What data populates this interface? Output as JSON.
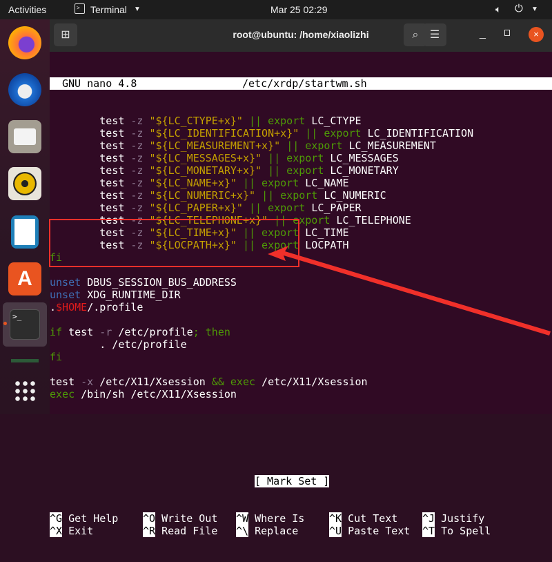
{
  "topbar": {
    "activities": "Activities",
    "app": "Terminal",
    "datetime": "Mar 25  02:29"
  },
  "dock": [
    "firefox",
    "thunderbird",
    "files",
    "rhythmbox",
    "libreoffice-writer",
    "software-center",
    "terminal",
    "show-apps"
  ],
  "window": {
    "title": "root@ubuntu: /home/xiaolizhi"
  },
  "nano": {
    "version": "GNU nano 4.8",
    "file": "/etc/xrdp/startwm.sh",
    "status": "[ Mark Set ]"
  },
  "lines": [
    [
      [
        "        test ",
        ""
      ],
      [
        "-z ",
        "op"
      ],
      [
        "\"${LC_CTYPE+x}\" ",
        "str"
      ],
      [
        "|| export ",
        "kw"
      ],
      [
        "LC_CTYPE",
        ""
      ]
    ],
    [
      [
        "        test ",
        ""
      ],
      [
        "-z ",
        "op"
      ],
      [
        "\"${LC_IDENTIFICATION+x}\" ",
        "str"
      ],
      [
        "|| export ",
        "kw"
      ],
      [
        "LC_IDENTIFICATION",
        ""
      ]
    ],
    [
      [
        "        test ",
        ""
      ],
      [
        "-z ",
        "op"
      ],
      [
        "\"${LC_MEASUREMENT+x}\" ",
        "str"
      ],
      [
        "|| export ",
        "kw"
      ],
      [
        "LC_MEASUREMENT",
        ""
      ]
    ],
    [
      [
        "        test ",
        ""
      ],
      [
        "-z ",
        "op"
      ],
      [
        "\"${LC_MESSAGES+x}\" ",
        "str"
      ],
      [
        "|| export ",
        "kw"
      ],
      [
        "LC_MESSAGES",
        ""
      ]
    ],
    [
      [
        "        test ",
        ""
      ],
      [
        "-z ",
        "op"
      ],
      [
        "\"${LC_MONETARY+x}\" ",
        "str"
      ],
      [
        "|| export ",
        "kw"
      ],
      [
        "LC_MONETARY",
        ""
      ]
    ],
    [
      [
        "        test ",
        ""
      ],
      [
        "-z ",
        "op"
      ],
      [
        "\"${LC_NAME+x}\" ",
        "str"
      ],
      [
        "|| export ",
        "kw"
      ],
      [
        "LC_NAME",
        ""
      ]
    ],
    [
      [
        "        test ",
        ""
      ],
      [
        "-z ",
        "op"
      ],
      [
        "\"${LC_NUMERIC+x}\" ",
        "str"
      ],
      [
        "|| export ",
        "kw"
      ],
      [
        "LC_NUMERIC",
        ""
      ]
    ],
    [
      [
        "        test ",
        ""
      ],
      [
        "-z ",
        "op"
      ],
      [
        "\"${LC_PAPER+x}\" ",
        "str"
      ],
      [
        "|| export ",
        "kw"
      ],
      [
        "LC_PAPER",
        ""
      ]
    ],
    [
      [
        "        test ",
        ""
      ],
      [
        "-z ",
        "op"
      ],
      [
        "\"${LC_TELEPHONE+x}\" ",
        "str"
      ],
      [
        "|| export ",
        "kw"
      ],
      [
        "LC_TELEPHONE",
        ""
      ]
    ],
    [
      [
        "        test ",
        ""
      ],
      [
        "-z ",
        "op"
      ],
      [
        "\"${LC_TIME+x}\" ",
        "str"
      ],
      [
        "|| export ",
        "kw"
      ],
      [
        "LC_TIME",
        ""
      ]
    ],
    [
      [
        "        test ",
        ""
      ],
      [
        "-z ",
        "op"
      ],
      [
        "\"${LOCPATH+x}\" ",
        "str"
      ],
      [
        "|| export ",
        "kw"
      ],
      [
        "LOCPATH",
        ""
      ]
    ],
    [
      [
        "fi",
        "kw"
      ]
    ],
    [],
    [
      [
        "unset ",
        "bl"
      ],
      [
        "DBUS_SESSION_BUS_ADDRESS",
        ""
      ]
    ],
    [
      [
        "unset ",
        "bl"
      ],
      [
        "XDG_RUNTIME_DIR",
        ""
      ]
    ],
    [
      [
        ".",
        ""
      ],
      [
        "$HOME",
        "rd"
      ],
      [
        "/.profile",
        ""
      ]
    ],
    [],
    [
      [
        "if ",
        "kw"
      ],
      [
        "test ",
        ""
      ],
      [
        "-r ",
        "op"
      ],
      [
        "/etc/profile",
        ""
      ],
      [
        "; then",
        "kw"
      ]
    ],
    [
      [
        "        . /etc/profile",
        ""
      ]
    ],
    [
      [
        "fi",
        "kw"
      ]
    ],
    [],
    [
      [
        "test ",
        ""
      ],
      [
        "-x ",
        "op"
      ],
      [
        "/etc/X11/Xsession ",
        ""
      ],
      [
        "&& exec ",
        "kw"
      ],
      [
        "/etc/X11/Xsession",
        ""
      ]
    ],
    [
      [
        "exec ",
        "kw"
      ],
      [
        "/bin/sh /etc/X11/Xsession",
        ""
      ]
    ]
  ],
  "shortcuts": [
    [
      {
        "key": "^G",
        "label": "Get Help"
      },
      {
        "key": "^O",
        "label": "Write Out"
      },
      {
        "key": "^W",
        "label": "Where Is"
      },
      {
        "key": "^K",
        "label": "Cut Text"
      },
      {
        "key": "^J",
        "label": "Justify"
      }
    ],
    [
      {
        "key": "^X",
        "label": "Exit"
      },
      {
        "key": "^R",
        "label": "Read File"
      },
      {
        "key": "^\\",
        "label": "Replace"
      },
      {
        "key": "^U",
        "label": "Paste Text"
      },
      {
        "key": "^T",
        "label": "To Spell"
      }
    ]
  ],
  "colors": {
    "terminal_bg": "#300a24",
    "annotation": "#f0302a"
  }
}
